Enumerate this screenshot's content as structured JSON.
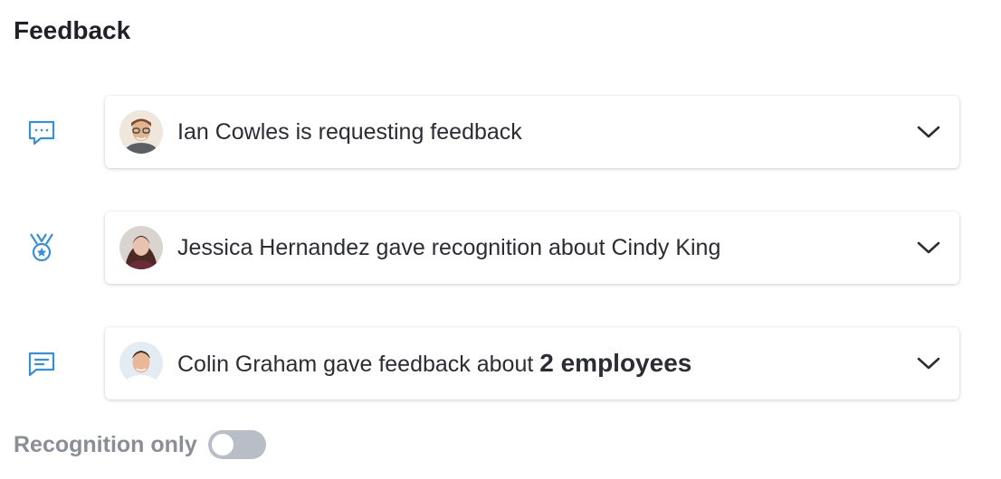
{
  "header": {
    "title": "Feedback"
  },
  "items": [
    {
      "type_icon": "chat-dots-icon",
      "avatar": "avatar-ian-cowles",
      "text": "Ian Cowles is requesting feedback",
      "bold_suffix": ""
    },
    {
      "type_icon": "medal-icon",
      "avatar": "avatar-jessica-hernandez",
      "text": "Jessica Hernandez gave recognition about Cindy King",
      "bold_suffix": ""
    },
    {
      "type_icon": "message-lines-icon",
      "avatar": "avatar-colin-graham",
      "text": "Colin Graham gave feedback about ",
      "bold_suffix": "2 employees"
    }
  ],
  "filter": {
    "label": "Recognition only",
    "enabled": false
  },
  "colors": {
    "accent": "#3b8fd1",
    "toggle_off": "#b9bec6"
  }
}
